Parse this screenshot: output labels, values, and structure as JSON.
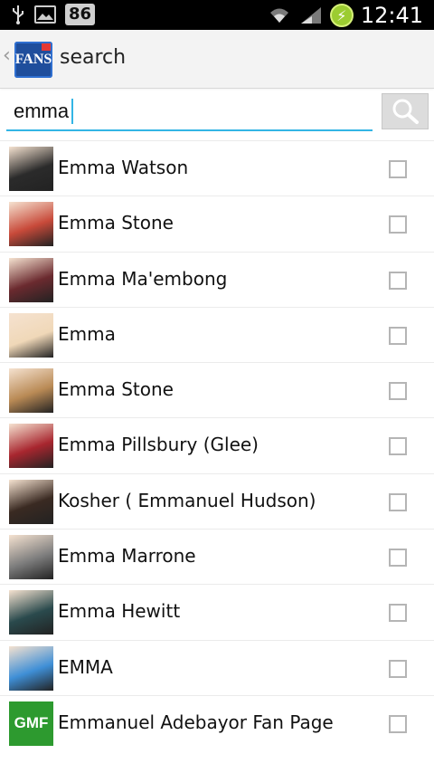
{
  "status_bar": {
    "battery_level": "86",
    "time": "12:41",
    "battery_icon": "lightning-icon"
  },
  "action_bar": {
    "logo_text": "FANS",
    "title": "search"
  },
  "search": {
    "value": "emma",
    "button_icon": "search-icon"
  },
  "results": [
    {
      "name": "Emma Watson",
      "avatar_color": "#2b2b2b"
    },
    {
      "name": "Emma Stone",
      "avatar_color": "#c84a3a"
    },
    {
      "name": "Emma Ma'embong",
      "avatar_color": "#6b2a2f"
    },
    {
      "name": "Emma",
      "avatar_color": "#f0d8b8"
    },
    {
      "name": "Emma Stone",
      "avatar_color": "#b98a55"
    },
    {
      "name": "Emma Pillsbury (Glee)",
      "avatar_color": "#a8262f"
    },
    {
      "name": "Kosher ( Emmanuel Hudson)",
      "avatar_color": "#3a2a22"
    },
    {
      "name": "Emma Marrone",
      "avatar_color": "#7d7d7d"
    },
    {
      "name": "Emma Hewitt",
      "avatar_color": "#2a4a4d"
    },
    {
      "name": "EMMA",
      "avatar_color": "#3f8fd6"
    },
    {
      "name": "Emmanuel Adebayor Fan Page",
      "avatar_color": "#2d9a2f",
      "avatar_text": "GMF"
    }
  ]
}
